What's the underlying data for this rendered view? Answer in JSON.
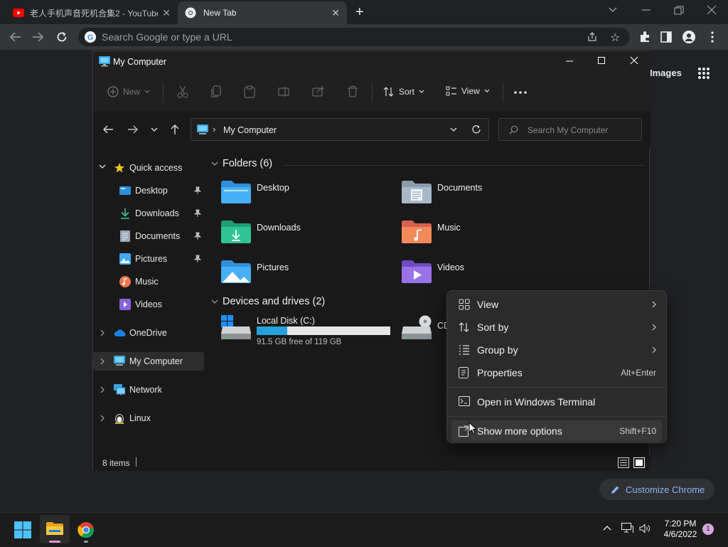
{
  "browser": {
    "tabs": [
      {
        "title": "老人手机声音死机合集2 - YouTube",
        "active": false
      },
      {
        "title": "New Tab",
        "active": true
      }
    ],
    "omnibox_placeholder": "Search Google or type a URL",
    "ntp": {
      "images_link": "Images",
      "customize_label": "Customize Chrome"
    }
  },
  "explorer": {
    "title": "My Computer",
    "commands": {
      "new": "New",
      "sort": "Sort",
      "view": "View"
    },
    "address": "My Computer",
    "search_placeholder": "Search My Computer",
    "nav": {
      "quick_access": "Quick access",
      "quick_items": [
        "Desktop",
        "Downloads",
        "Documents",
        "Pictures",
        "Music",
        "Videos"
      ],
      "onedrive": "OneDrive",
      "my_computer": "My Computer",
      "network": "Network",
      "linux": "Linux"
    },
    "folders_header": "Folders (6)",
    "folders": [
      "Desktop",
      "Documents",
      "Downloads",
      "Music",
      "Pictures",
      "Videos"
    ],
    "drives_header": "Devices and drives (2)",
    "drives": [
      {
        "name": "Local Disk (C:)",
        "detail": "91.5 GB free of 119 GB",
        "used_fraction": 0.23
      },
      {
        "name": "CD"
      }
    ],
    "status": "8 items"
  },
  "context_menu": {
    "items": [
      {
        "label": "View",
        "accel": "",
        "submenu": true
      },
      {
        "label": "Sort by",
        "accel": "",
        "submenu": true
      },
      {
        "label": "Group by",
        "accel": "",
        "submenu": true
      },
      {
        "label": "Properties",
        "accel": "Alt+Enter",
        "submenu": false
      },
      {
        "label": "Open in Windows Terminal",
        "accel": "",
        "submenu": false
      },
      {
        "label": "Show more options",
        "accel": "Shift+F10",
        "submenu": false
      }
    ]
  },
  "taskbar": {
    "time": "7:20 PM",
    "date": "4/6/2022",
    "notification_count": "1"
  },
  "colors": {
    "accent": "#60cdff",
    "folder_blue": "#3a9ff0",
    "progress": "#26a0da",
    "chrome_bg": "#202124"
  }
}
